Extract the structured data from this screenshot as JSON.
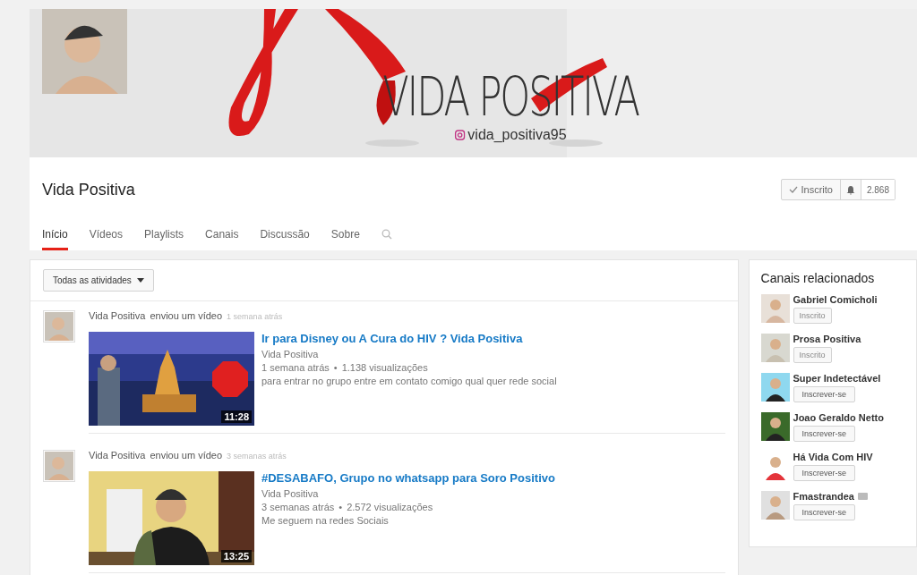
{
  "banner": {
    "title": "VIDA POSITIVA",
    "handle": "vida_positiva95"
  },
  "channel": {
    "name": "Vida Positiva",
    "subscribe_label": "Inscrito",
    "subscriber_count": "2.868"
  },
  "tabs": [
    {
      "label": "Início",
      "selected": true
    },
    {
      "label": "Vídeos",
      "selected": false
    },
    {
      "label": "Playlists",
      "selected": false
    },
    {
      "label": "Canais",
      "selected": false
    },
    {
      "label": "Discussão",
      "selected": false
    },
    {
      "label": "Sobre",
      "selected": false
    }
  ],
  "filter": {
    "label": "Todas as atividades"
  },
  "feed": [
    {
      "author": "Vida Positiva",
      "action": "enviou um vídeo",
      "time": "1 semana atrás",
      "title": "Ir para Disney ou A Cura do HIV ? Vida Positiva",
      "channel": "Vida Positiva",
      "meta_time": "1 semana atrás",
      "views": "1.138 visualizações",
      "description": "para entrar no grupo entre em contato comigo qual quer rede social",
      "duration": "11:28",
      "separator": "•"
    },
    {
      "author": "Vida Positiva",
      "action": "enviou um vídeo",
      "time": "3 semanas atrás",
      "title": "#DESABAFO, Grupo no whatsapp para Soro Positivo",
      "channel": "Vida Positiva",
      "meta_time": "3 semanas atrás",
      "views": "2.572 visualizações",
      "description": "Me seguem na redes Sociais",
      "duration": "13:25",
      "separator": "•"
    }
  ],
  "related": {
    "title": "Canais relacionados",
    "channels": [
      {
        "name": "Gabriel Comicholi",
        "button": "Inscrito",
        "subscribed": true,
        "verified": false
      },
      {
        "name": "Prosa Positiva",
        "button": "Inscrito",
        "subscribed": true,
        "verified": false
      },
      {
        "name": "Super Indetectável",
        "button": "Inscrever-se",
        "subscribed": false,
        "verified": false
      },
      {
        "name": "Joao Geraldo Netto",
        "button": "Inscrever-se",
        "subscribed": false,
        "verified": false
      },
      {
        "name": "Há Vida Com HIV",
        "button": "Inscrever-se",
        "subscribed": false,
        "verified": false
      },
      {
        "name": "Fmastrandea",
        "button": "Inscrever-se",
        "subscribed": false,
        "verified": true
      }
    ]
  }
}
